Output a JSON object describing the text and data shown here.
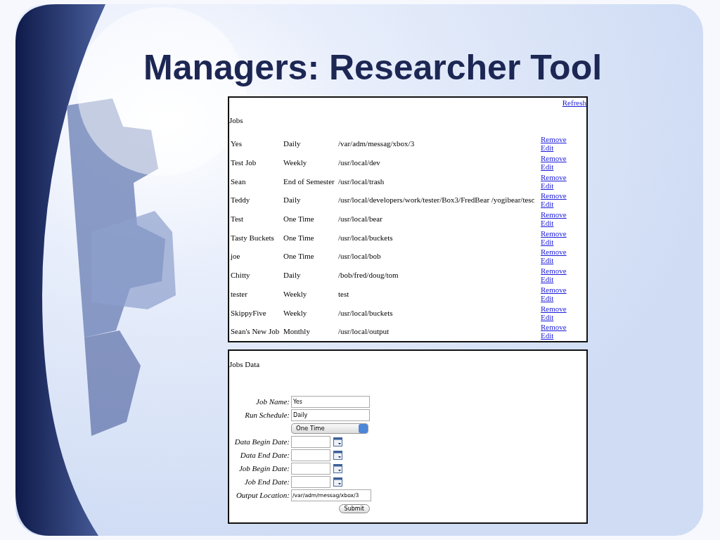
{
  "slide": {
    "title": "Managers: Researcher Tool"
  },
  "jobs_panel": {
    "refresh_link": "Refresh",
    "heading": "Jobs",
    "rows": [
      {
        "name": "Yes",
        "schedule": "Daily",
        "location": "/var/adm/messag/xbox/3",
        "remove_link": "Remove",
        "edit_link": "Edit"
      },
      {
        "name": "Test Job",
        "schedule": "Weekly",
        "location": "/usr/local/dev",
        "remove_link": "Remove",
        "edit_link": "Edit"
      },
      {
        "name": "Sean",
        "schedule": "End of Semester",
        "location": "/usr/local/trash",
        "remove_link": "Remove",
        "edit_link": "Edit"
      },
      {
        "name": "Teddy",
        "schedule": "Daily",
        "location": "/usr/local/developers/work/tester/Box3/FredBear /yogibear/tesc",
        "remove_link": "Remove",
        "edit_link": "Edit"
      },
      {
        "name": "Test",
        "schedule": "One Time",
        "location": "/usr/local/bear",
        "remove_link": "Remove",
        "edit_link": "Edit"
      },
      {
        "name": "Tasty Buckets",
        "schedule": "One Time",
        "location": "/usr/local/buckets",
        "remove_link": "Remove",
        "edit_link": "Edit"
      },
      {
        "name": "joe",
        "schedule": "One Time",
        "location": "/usr/local/bob",
        "remove_link": "Remove",
        "edit_link": "Edit"
      },
      {
        "name": "Chitty",
        "schedule": "Daily",
        "location": "/bob/fred/doug/tom",
        "remove_link": "Remove",
        "edit_link": "Edit"
      },
      {
        "name": "tester",
        "schedule": "Weekly",
        "location": "test",
        "remove_link": "Remove",
        "edit_link": "Edit"
      },
      {
        "name": "SkippyFive",
        "schedule": "Weekly",
        "location": "/usr/local/buckets",
        "remove_link": "Remove",
        "edit_link": "Edit"
      },
      {
        "name": "Sean's New Job",
        "schedule": "Monthly",
        "location": "/usr/local/output",
        "remove_link": "Remove",
        "edit_link": "Edit"
      }
    ]
  },
  "jobs_data_panel": {
    "heading": "Jobs Data",
    "fields": [
      {
        "kind": "text",
        "label": "Job Name:",
        "value": "Yes"
      },
      {
        "kind": "text",
        "label": "Run Schedule:",
        "value": "Daily"
      },
      {
        "kind": "select",
        "value": "One Time"
      },
      {
        "kind": "date",
        "label": "Data Begin Date:"
      },
      {
        "kind": "date",
        "label": "Data End Date:"
      },
      {
        "kind": "date",
        "label": "Job Begin Date:"
      },
      {
        "kind": "date",
        "label": "Job End Date:"
      },
      {
        "kind": "text",
        "label": "Output Location:",
        "value": "/var/adm/messag/xbox/3"
      }
    ],
    "submit_button": "Submit"
  }
}
